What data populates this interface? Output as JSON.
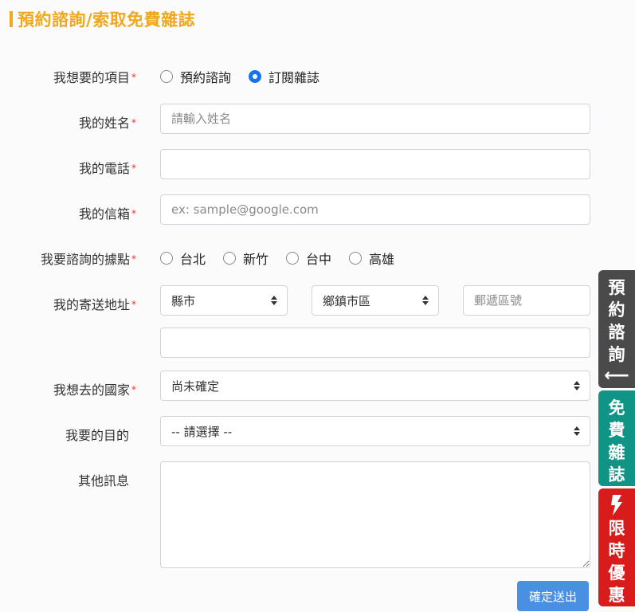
{
  "page": {
    "title": "預約諮詢/索取免費雜誌",
    "accent_color": "#f0a81e"
  },
  "form": {
    "item": {
      "label": "我想要的項目",
      "options": [
        "預約諮詢",
        "訂閱雜誌"
      ],
      "selected": "訂閱雜誌"
    },
    "name": {
      "label": "我的姓名",
      "placeholder": "請輸入姓名",
      "value": ""
    },
    "phone": {
      "label": "我的電話",
      "value": ""
    },
    "email": {
      "label": "我的信箱",
      "placeholder": "ex: sample@google.com",
      "value": ""
    },
    "location": {
      "label": "我要諮詢的據點",
      "options": [
        "台北",
        "新竹",
        "台中",
        "高雄"
      ],
      "selected": ""
    },
    "address": {
      "label": "我的寄送地址",
      "city": "縣市",
      "district": "鄉鎮市區",
      "zip_placeholder": "郵遞區號",
      "street_value": ""
    },
    "country": {
      "label": "我想去的國家",
      "selected": "尚未確定"
    },
    "purpose": {
      "label": "我要的目的",
      "selected": "-- 請選擇 --"
    },
    "message": {
      "label": "其他訊息",
      "value": ""
    },
    "required_mark": "*",
    "submit_label": "確定送出"
  },
  "side_tabs": {
    "consult": {
      "chars": [
        "預",
        "約",
        "諮",
        "詢"
      ],
      "arrow": "⟵",
      "color": "#4a4a4a"
    },
    "magazine": {
      "chars": [
        "免",
        "費",
        "雜",
        "誌"
      ],
      "color": "#0f9486"
    },
    "offer": {
      "icon": "lightning-icon",
      "chars": [
        "限",
        "時",
        "優",
        "惠"
      ],
      "color": "#d81b1b"
    }
  }
}
